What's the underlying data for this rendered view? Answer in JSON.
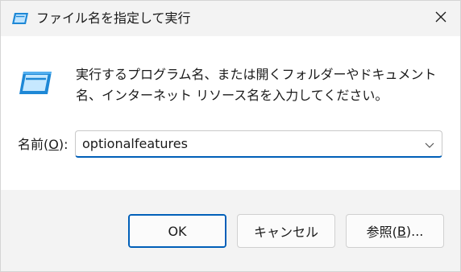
{
  "window": {
    "title": "ファイル名を指定して実行",
    "title_icon": "run-icon",
    "close_icon": "close-icon"
  },
  "content": {
    "icon": "run-icon",
    "description": "実行するプログラム名、または開くフォルダーやドキュメント名、インターネット リソース名を入力してください。"
  },
  "name_field": {
    "label_prefix": "名前(",
    "label_mnemonic": "O",
    "label_suffix": "):",
    "value": "optionalfeatures",
    "dropdown_icon": "chevron-down-icon"
  },
  "buttons": {
    "ok_label": "OK",
    "cancel_label": "キャンセル",
    "browse_prefix": "参照(",
    "browse_mnemonic": "B",
    "browse_suffix": ")..."
  },
  "colors": {
    "accent": "#005fb8",
    "window_bg": "#f3f3f3",
    "content_bg": "#ffffff"
  }
}
